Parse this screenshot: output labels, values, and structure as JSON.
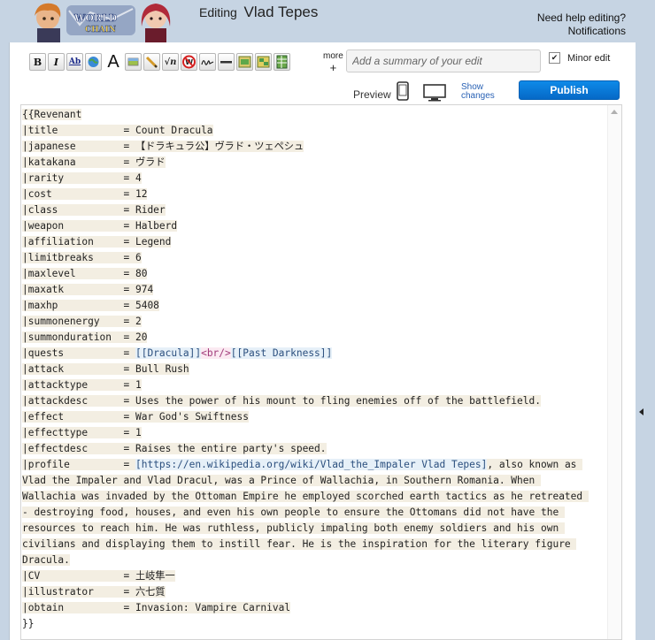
{
  "header": {
    "editing_prefix": "Editing",
    "page_title": "Vlad Tepes",
    "help_line1": "Need help editing?",
    "help_line2": "Notifications"
  },
  "toolbar": {
    "buttons": [
      "bold",
      "italic",
      "internal-link",
      "external-link",
      "font-size",
      "image",
      "signature-line",
      "math",
      "no-wiki",
      "signature",
      "horizontal-rule",
      "gallery",
      "slideshow",
      "table"
    ],
    "more_label": "more",
    "more_plus": "+",
    "summary_placeholder": "Add a summary of your edit",
    "minor_edit_label": "Minor edit",
    "minor_edit_checked": true
  },
  "publish": {
    "preview_label": "Preview",
    "show_changes_line1": "Show",
    "show_changes_line2": "changes",
    "publish_label": "Publish"
  },
  "colors": {
    "background": "#c6d4e3",
    "publish": "#0a7ae0",
    "template_highlight": "#f3eee2",
    "link_highlight": "#e6f0f8",
    "tag_color": "#a03a7a"
  },
  "source": {
    "lines": [
      [
        {
          "t": "{{Revenant",
          "c": "tpl"
        }
      ],
      [
        {
          "t": "|title           = Count Dracula",
          "c": "tpl"
        }
      ],
      [
        {
          "t": "|japanese        = 【ドラキュラ公】ヴラド・ツェペシュ",
          "c": "tpl"
        }
      ],
      [
        {
          "t": "|katakana        = ヴラド",
          "c": "tpl"
        }
      ],
      [
        {
          "t": "|rarity          = 4",
          "c": "tpl"
        }
      ],
      [
        {
          "t": "|cost            = 12",
          "c": "tpl"
        }
      ],
      [
        {
          "t": "|class           = Rider",
          "c": "tpl"
        }
      ],
      [
        {
          "t": "|weapon          = Halberd",
          "c": "tpl"
        }
      ],
      [
        {
          "t": "|affiliation     = Legend",
          "c": "tpl"
        }
      ],
      [
        {
          "t": "|limitbreaks     = 6",
          "c": "tpl"
        }
      ],
      [
        {
          "t": "|maxlevel        = 80",
          "c": "tpl"
        }
      ],
      [
        {
          "t": "|maxatk          = 974",
          "c": "tpl"
        }
      ],
      [
        {
          "t": "|maxhp           = 5408",
          "c": "tpl"
        }
      ],
      [
        {
          "t": "|summonenergy    = 2",
          "c": "tpl"
        }
      ],
      [
        {
          "t": "|summonduration  = 20",
          "c": "tpl"
        }
      ],
      [
        {
          "t": "|quests          = ",
          "c": "tpl"
        },
        {
          "t": "[[Dracula]]",
          "c": "lnk"
        },
        {
          "t": "<br/>",
          "c": "tag"
        },
        {
          "t": "[[Past Darkness]]",
          "c": "lnk"
        }
      ],
      [
        {
          "t": "|attack          = Bull Rush",
          "c": "tpl"
        }
      ],
      [
        {
          "t": "|attacktype      = 1",
          "c": "tpl"
        }
      ],
      [
        {
          "t": "|attackdesc      = Uses the power of his mount to fling enemies off of the battlefield.",
          "c": "tpl"
        }
      ],
      [
        {
          "t": "|effect          = War God's Swiftness",
          "c": "tpl"
        }
      ],
      [
        {
          "t": "|effecttype      = 1",
          "c": "tpl"
        }
      ],
      [
        {
          "t": "|effectdesc      = Raises the entire party's speed.",
          "c": "tpl"
        }
      ],
      [
        {
          "t": "|profile         = ",
          "c": "tpl"
        },
        {
          "t": "[https://en.wikipedia.org/wiki/Vlad_the_Impaler Vlad Tepes]",
          "c": "ext"
        },
        {
          "t": ", also known as ",
          "c": "tpl"
        }
      ],
      [
        {
          "t": "Vlad the Impaler and Vlad Dracul, was a Prince of Wallachia, in Southern Romania. When ",
          "c": "tpl"
        }
      ],
      [
        {
          "t": "Wallachia was invaded by the Ottoman Empire he employed scorched earth tactics as he retreated ",
          "c": "tpl"
        }
      ],
      [
        {
          "t": "- destroying food, houses, and even his own people to ensure the Ottomans did not have the ",
          "c": "tpl"
        }
      ],
      [
        {
          "t": "resources to reach him. He was ruthless, publicly impaling both enemy soldiers and his own ",
          "c": "tpl"
        }
      ],
      [
        {
          "t": "civilians and displaying them to instill fear. He is the inspiration for the literary figure ",
          "c": "tpl"
        }
      ],
      [
        {
          "t": "Dracula.",
          "c": "tpl"
        }
      ],
      [
        {
          "t": "|CV              = 土岐隼一",
          "c": "tpl"
        }
      ],
      [
        {
          "t": "|illustrator     = 六七質",
          "c": "tpl"
        }
      ],
      [
        {
          "t": "|obtain          = Invasion: Vampire Carnival",
          "c": "tpl"
        }
      ],
      [
        {
          "t": "}}",
          "c": ""
        }
      ]
    ]
  }
}
